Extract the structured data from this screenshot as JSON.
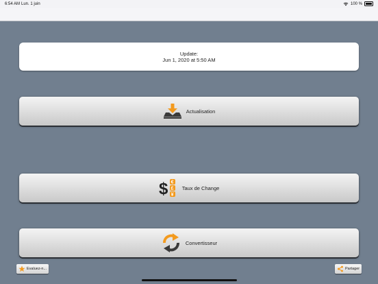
{
  "status_bar": {
    "time": "6:54 AM",
    "date": "Lun. 1 juin",
    "battery": "100 %"
  },
  "update_card": {
    "line1": "Update:",
    "line2": "Jun 1, 2020 at 5:50 AM"
  },
  "buttons": {
    "refresh": "Actualisation",
    "rates": "Taux de Change",
    "converter": "Convertisseur"
  },
  "bottom": {
    "rate_app": "Evaluez-n...",
    "share": "Partager"
  },
  "colors": {
    "background": "#717f8f",
    "accent_orange": "#f39a1e"
  }
}
